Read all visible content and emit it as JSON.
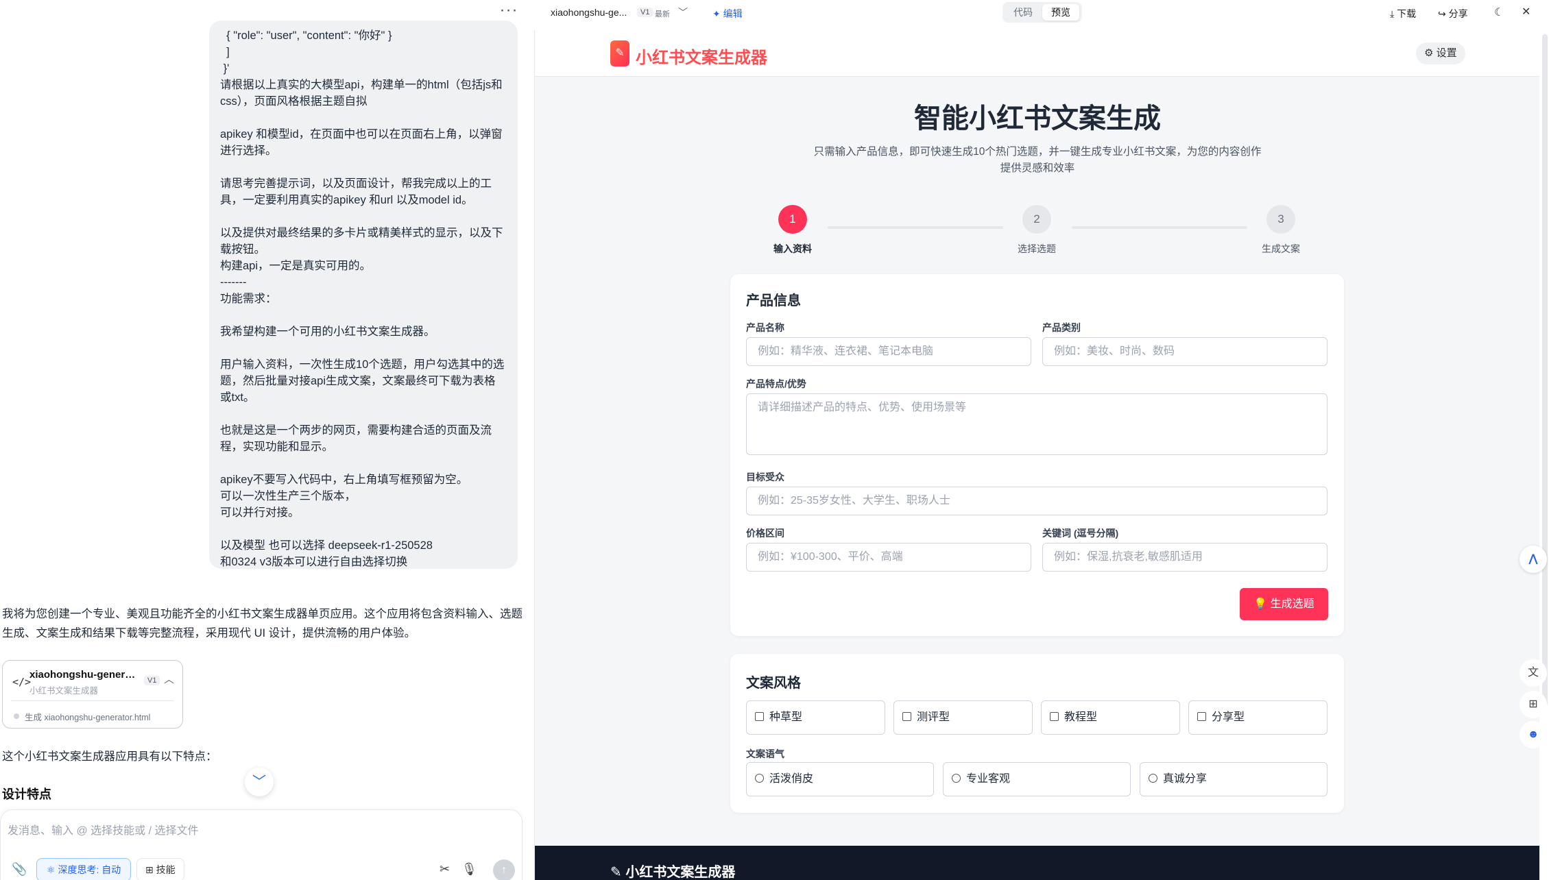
{
  "chat": {
    "more_label": "···",
    "user_message": "  { \"role\": \"user\", \"content\": \"你好\" }\n  ]\n }'\n请根据以上真实的大模型api，构建单一的html（包括js和css），页面风格根据主题自拟\n\napikey 和模型id，在页面中也可以在页面右上角，以弹窗进行选择。\n\n请思考完善提示词，以及页面设计，帮我完成以上的工具，一定要利用真实的apikey 和url 以及model id。\n\n以及提供对最终结果的多卡片或精美样式的显示，以及下载按钮。\n构建api，一定是真实可用的。\n-------\n功能需求：\n\n我希望构建一个可用的小红书文案生成器。\n\n用户输入资料，一次性生成10个选题，用户勾选其中的选题，然后批量对接api生成文案，文案最终可下载为表格或txt。\n\n也就是这是一个两步的网页，需要构建合适的页面及流程，实现功能和显示。\n\napikey不要写入代码中，右上角填写框预留为空。\n可以一次性生产三个版本，\n可以并行对接。\n\n以及模型 也可以选择 deepseek-r1-250528\n和0324 v3版本可以进行自由选择切换",
    "assistant_intro": "我将为您创建一个专业、美观且功能齐全的小红书文案生成器单页应用。这个应用将包含资料输入、选题生成、文案生成和结果下载等完整流程，采用现代 UI 设计，提供流畅的用户体验。",
    "artifact": {
      "title": "xiaohongshu-generator",
      "subtitle": "小红书文案生成器",
      "version": "V1",
      "generated": "生成 xiaohongshu-generator.html"
    },
    "features_intro": "这个小红书文案生成器应用具有以下特点：",
    "design_heading": "设计特点",
    "composer": {
      "placeholder": "发消息、输入 @ 选择技能或 / 选择文件",
      "deep_think": "深度思考: 自动",
      "skills": "技能"
    }
  },
  "preview_bar": {
    "file_name": "xiaohongshu-ge...",
    "version": "V1",
    "latest": "最新",
    "edit": "编辑",
    "tab_code": "代码",
    "tab_preview": "预览",
    "download": "下载",
    "share": "分享"
  },
  "app": {
    "logo_text": "小红书文案生成器",
    "settings": "设置",
    "hero_title": "智能小红书文案生成",
    "hero_subtitle": "只需输入产品信息，即可快速生成10个热门选题，并一键生成专业小红书文案，为您的内容创作提供灵感和效率",
    "steps": [
      {
        "num": "1",
        "label": "输入资料"
      },
      {
        "num": "2",
        "label": "选择选题"
      },
      {
        "num": "3",
        "label": "生成文案"
      }
    ],
    "product_card": {
      "title": "产品信息",
      "name_label": "产品名称",
      "name_placeholder": "例如：精华液、连衣裙、笔记本电脑",
      "category_label": "产品类别",
      "category_placeholder": "例如：美妆、时尚、数码",
      "features_label": "产品特点/优势",
      "features_placeholder": "请详细描述产品的特点、优势、使用场景等",
      "audience_label": "目标受众",
      "audience_placeholder": "例如：25-35岁女性、大学生、职场人士",
      "price_label": "价格区间",
      "price_placeholder": "例如：¥100-300、平价、高端",
      "keywords_label": "关键词 (逗号分隔)",
      "keywords_placeholder": "例如：保湿,抗衰老,敏感肌适用",
      "generate_button": "生成选题"
    },
    "style_card": {
      "title": "文案风格",
      "styles": [
        "种草型",
        "测评型",
        "教程型",
        "分享型"
      ],
      "tone_label": "文案语气",
      "tones": [
        "活泼俏皮",
        "专业客观",
        "真诚分享"
      ]
    },
    "footer_logo": "小红书文案生成器"
  },
  "colors": {
    "accent": "#ff3358",
    "brand_text": "#ff4d4f",
    "link_blue": "#2563eb",
    "footer_bg": "#111827"
  }
}
